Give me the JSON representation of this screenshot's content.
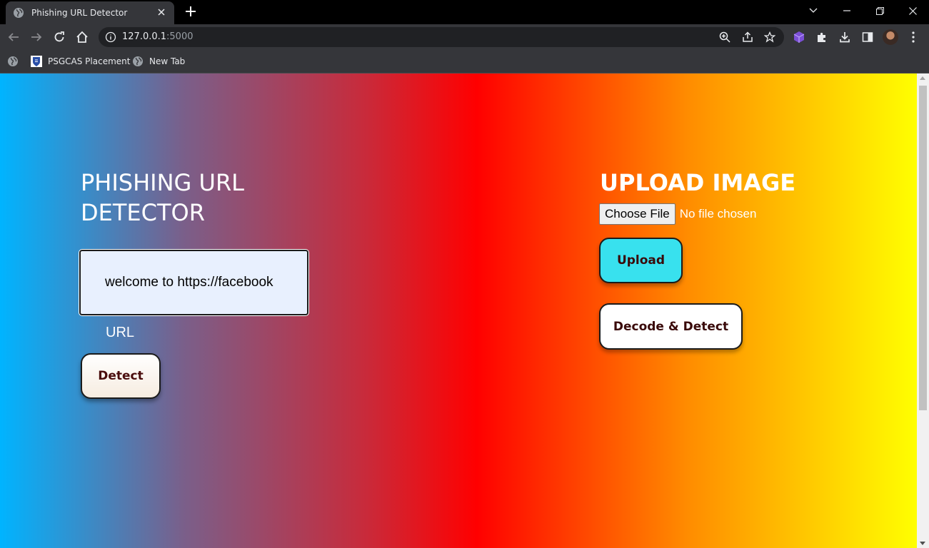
{
  "browser": {
    "tab_title": "Phishing URL Detector",
    "url_host": "127.0.0.1",
    "url_port": ":5000",
    "bookmarks": [
      {
        "label": "PSGCAS Placement"
      },
      {
        "label": "New Tab"
      }
    ]
  },
  "left_panel": {
    "title": "PHISHING URL DETECTOR",
    "url_input_value": "welcome to https://facebook",
    "url_label": "URL",
    "detect_button": "Detect"
  },
  "right_panel": {
    "title": "UPLOAD IMAGE",
    "choose_file_button": "Choose File",
    "no_file_text": "No file chosen",
    "upload_button": "Upload",
    "decode_button": "Decode & Detect"
  },
  "colors": {
    "upload_button_bg": "#38e1ee",
    "button_text": "#4a0d0d",
    "gradient_stops": [
      "#00b4ff",
      "#7a5f8a",
      "#c92a3a",
      "#ff0000",
      "#ff8c00",
      "#ffff00"
    ]
  },
  "icons": {
    "tab_favicon": "globe-icon",
    "bookmark_1": "psg-logo-icon",
    "bookmark_2": "globe-icon"
  }
}
